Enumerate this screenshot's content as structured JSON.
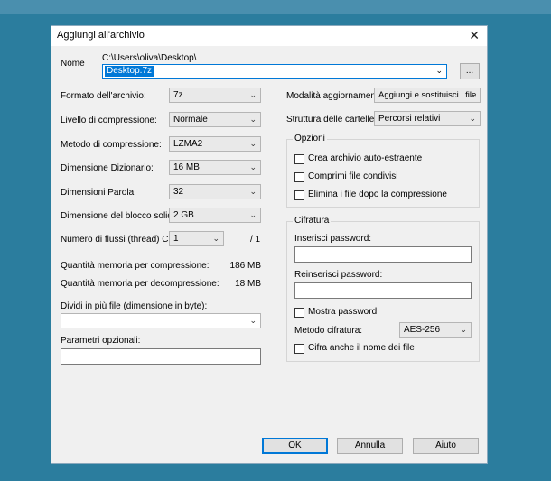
{
  "window": {
    "title": "Aggiungi all'archivio",
    "close_glyph": "✕"
  },
  "name": {
    "label": "Nome",
    "path": "C:\\Users\\oliva\\Desktop\\",
    "value": "Desktop.7z",
    "browse_label": "..."
  },
  "left": {
    "format_label": "Formato dell'archivio:",
    "format_value": "7z",
    "level_label": "Livello di compressione:",
    "level_value": "Normale",
    "method_label": "Metodo di compressione:",
    "method_value": "LZMA2",
    "dict_label": "Dimensione Dizionario:",
    "dict_value": "16 MB",
    "word_label": "Dimensioni Parola:",
    "word_value": "32",
    "solid_label": "Dimensione del blocco solido:",
    "solid_value": "2 GB",
    "threads_label": "Numero di flussi (thread) CPU:",
    "threads_value": "1",
    "threads_max": "/ 1",
    "mem_comp_label": "Quantità memoria per compressione:",
    "mem_comp_value": "186 MB",
    "mem_decomp_label": "Quantità memoria per decompressione:",
    "mem_decomp_value": "18 MB",
    "split_label": "Dividi in più file (dimensione in byte):",
    "split_value": "",
    "params_label": "Parametri opzionali:",
    "params_value": ""
  },
  "right": {
    "update_label": "Modalità aggiornamento:",
    "update_value": "Aggiungi e sostituisci i file",
    "paths_label": "Struttura delle cartelle:",
    "paths_value": "Percorsi relativi",
    "options": {
      "title": "Opzioni",
      "sfx": "Crea archivio auto-estraente",
      "shared": "Comprimi file condivisi",
      "delete": "Elimina i file dopo la compressione"
    },
    "encryption": {
      "title": "Cifratura",
      "pwd_label": "Inserisci password:",
      "pwd2_label": "Reinserisci password:",
      "show_label": "Mostra password",
      "method_label": "Metodo cifratura:",
      "method_value": "AES-256",
      "encrypt_names": "Cifra anche il nome dei file"
    }
  },
  "buttons": {
    "ok": "OK",
    "cancel": "Annulla",
    "help": "Aiuto"
  },
  "glyphs": {
    "dropdown": "⌄"
  },
  "colors": {
    "accent": "#0078d7",
    "background": "#2b7d9e",
    "dialog": "#f0f0f0"
  }
}
